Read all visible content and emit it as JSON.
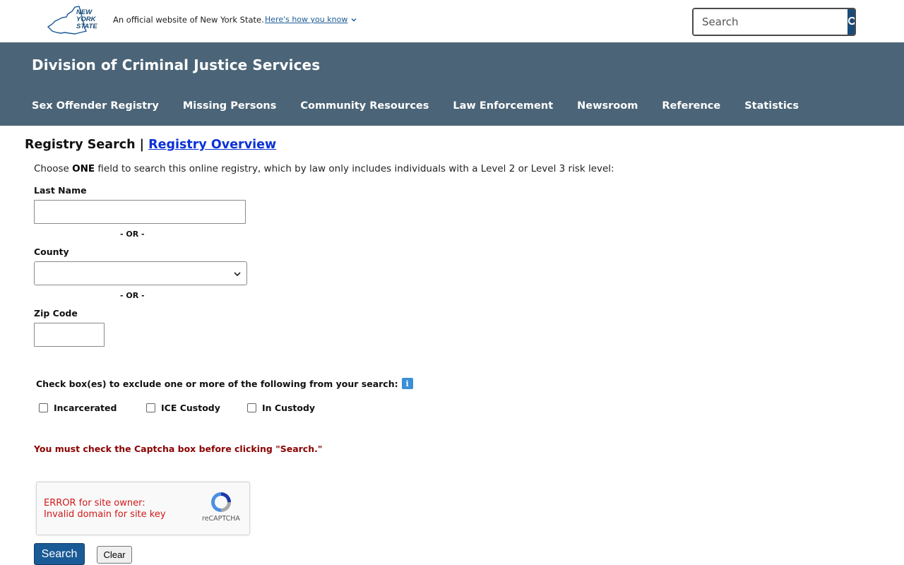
{
  "top_bar": {
    "logo_lines": [
      "NEW",
      "YORK",
      "STATE"
    ],
    "official_text": "An official website of New York State.",
    "how_you_know": "Here's how you know",
    "search_placeholder": "Search"
  },
  "agency": {
    "title": "Division of Criminal Justice Services",
    "nav": [
      "Sex Offender Registry",
      "Missing Persons",
      "Community Resources",
      "Law Enforcement",
      "Newsroom",
      "Reference",
      "Statistics"
    ]
  },
  "main": {
    "crumb_current": "Registry Search",
    "crumb_separator": "|",
    "crumb_link": "Registry Overview",
    "instructions_pre": "Choose ",
    "instructions_bold": "ONE",
    "instructions_post": " field to search this online registry, which by law only includes individuals with a Level 2 or Level 3 risk level:",
    "last_name_label": "Last Name",
    "or_text": "- OR -",
    "county_label": "County",
    "county_selected": "",
    "zip_label": "Zip Code",
    "exclude_text": "Check box(es) to exclude one or more of the following from your search:",
    "info_glyph": "i",
    "checkboxes": [
      "Incarcerated",
      "ICE Custody",
      "In Custody"
    ],
    "captcha_warning": "You must check the Captcha box before clicking \"Search.\"",
    "captcha_error_line1": "ERROR for site owner:",
    "captcha_error_line2": "Invalid domain for site key",
    "captcha_brand": "reCAPTCHA",
    "search_button": "Search",
    "clear_button": "Clear"
  }
}
